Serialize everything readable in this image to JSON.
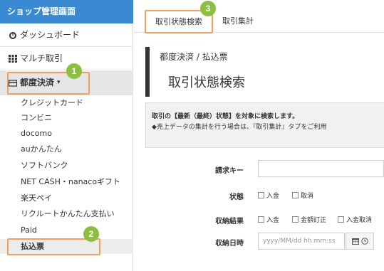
{
  "sidebar": {
    "header": "ショップ管理画面",
    "dashboard": "ダッシュボード",
    "multi": "マルチ取引",
    "periodic": "都度決済",
    "caret": "▾",
    "items": [
      "クレジットカード",
      "コンビニ",
      "docomo",
      "auかんたん",
      "ソフトバンク",
      "NET CASH・nanacoギフト",
      "楽天ペイ",
      "リクルートかんたん支払い",
      "Paid",
      "払込票"
    ]
  },
  "tabs": [
    "取引状態検索",
    "取引集計"
  ],
  "breadcrumb": "都度決済 / 払込票",
  "page_title": "取引状態検索",
  "notice": {
    "line1": "取引の【最新（最終）状態】を対象に検索します。",
    "line2": "◆売上データの集計を行う場合は、『取引集計』タブをご利用"
  },
  "form": {
    "request_key_label": "請求キー",
    "status_label": "状態",
    "status_options": [
      "入金",
      "取消"
    ],
    "payment_result_label": "収納結果",
    "payment_result_options": [
      "入金",
      "金額訂正",
      "入金取消"
    ],
    "payment_date_label": "収納日時",
    "payment_date_placeholder": "yyyy/MM/dd hh:mm:ss"
  },
  "badges": [
    "1",
    "2",
    "3"
  ],
  "colors": {
    "sidebar_header": "#3a8ad3",
    "highlight": "#f0a060",
    "badge": "#8cbf3f"
  },
  "icons": [
    "dashboard-icon",
    "grid-icon",
    "card-icon",
    "calendar-icon",
    "clock-icon"
  ]
}
